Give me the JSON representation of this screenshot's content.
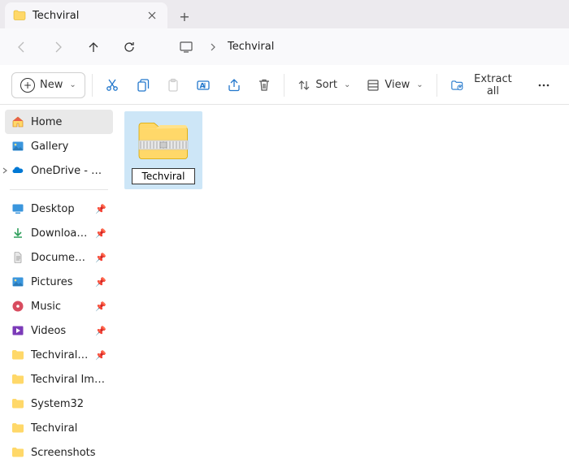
{
  "tab": {
    "title": "Techviral"
  },
  "path": {
    "current": "Techviral"
  },
  "toolbar": {
    "new_label": "New",
    "sort_label": "Sort",
    "view_label": "View",
    "extract_label": "Extract all"
  },
  "sidebar": {
    "top": [
      {
        "label": "Home",
        "icon": "home"
      },
      {
        "label": "Gallery",
        "icon": "gallery"
      },
      {
        "label": "OneDrive - Persona",
        "icon": "onedrive",
        "caret": true
      }
    ],
    "quick": [
      {
        "label": "Desktop",
        "icon": "desktop",
        "pinned": true
      },
      {
        "label": "Downloads",
        "icon": "downloads",
        "pinned": true
      },
      {
        "label": "Documents",
        "icon": "documents",
        "pinned": true
      },
      {
        "label": "Pictures",
        "icon": "pictures",
        "pinned": true
      },
      {
        "label": "Music",
        "icon": "music",
        "pinned": true
      },
      {
        "label": "Videos",
        "icon": "videos",
        "pinned": true
      },
      {
        "label": "Techviral Docum",
        "icon": "folder",
        "pinned": true
      },
      {
        "label": "Techviral Images",
        "icon": "folder",
        "pinned": false
      },
      {
        "label": "System32",
        "icon": "folder",
        "pinned": false
      },
      {
        "label": "Techviral",
        "icon": "folder",
        "pinned": false
      },
      {
        "label": "Screenshots",
        "icon": "folder",
        "pinned": false
      }
    ]
  },
  "content": {
    "items": [
      {
        "name": "Techviral",
        "type": "zip",
        "selected": true,
        "renaming": true
      }
    ]
  }
}
